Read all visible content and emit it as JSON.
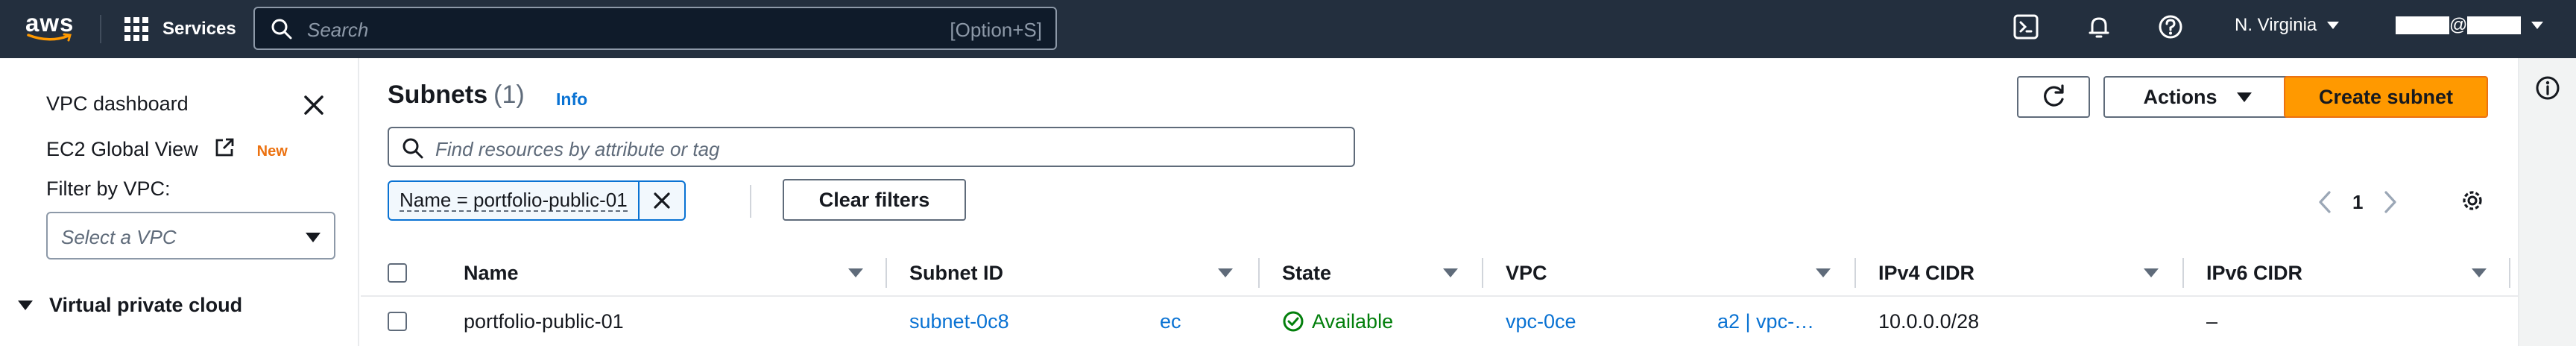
{
  "topnav": {
    "logo_text": "aws",
    "services_label": "Services",
    "search_placeholder": "Search",
    "search_shortcut": "[Option+S]",
    "region_label": "N. Virginia",
    "account_label": "@",
    "icons": [
      "cloudshell-icon",
      "notifications-bell-icon",
      "help-icon"
    ]
  },
  "sidebar": {
    "dashboard_label": "VPC dashboard",
    "global_view_label": "EC2 Global View",
    "new_badge": "New",
    "filter_label": "Filter by VPC:",
    "vpc_select_placeholder": "Select a VPC",
    "section_label": "Virtual private cloud"
  },
  "header": {
    "title": "Subnets",
    "count": "(1)",
    "info_link": "Info",
    "actions_label": "Actions",
    "create_label": "Create subnet"
  },
  "filter": {
    "placeholder": "Find resources by attribute or tag",
    "token_label": "Name = portfolio-public-01",
    "clear_label": "Clear filters"
  },
  "pagination": {
    "current_page": "1"
  },
  "table": {
    "columns": [
      "Name",
      "Subnet ID",
      "State",
      "VPC",
      "IPv4 CIDR",
      "IPv6 CIDR"
    ],
    "rows": [
      {
        "name": "portfolio-public-01",
        "subnet_id": "subnet-0c8",
        "subnet_id_tail": "ec",
        "state": "Available",
        "vpc": "vpc-0ce",
        "vpc_tail": "a2 | vpc-…",
        "ipv4_cidr": "10.0.0.0/28",
        "ipv6_cidr": "–"
      }
    ]
  },
  "colors": {
    "nav_bg": "#232f3e",
    "primary_button": "#ff9900",
    "link": "#0972d3",
    "success": "#037f0c"
  }
}
